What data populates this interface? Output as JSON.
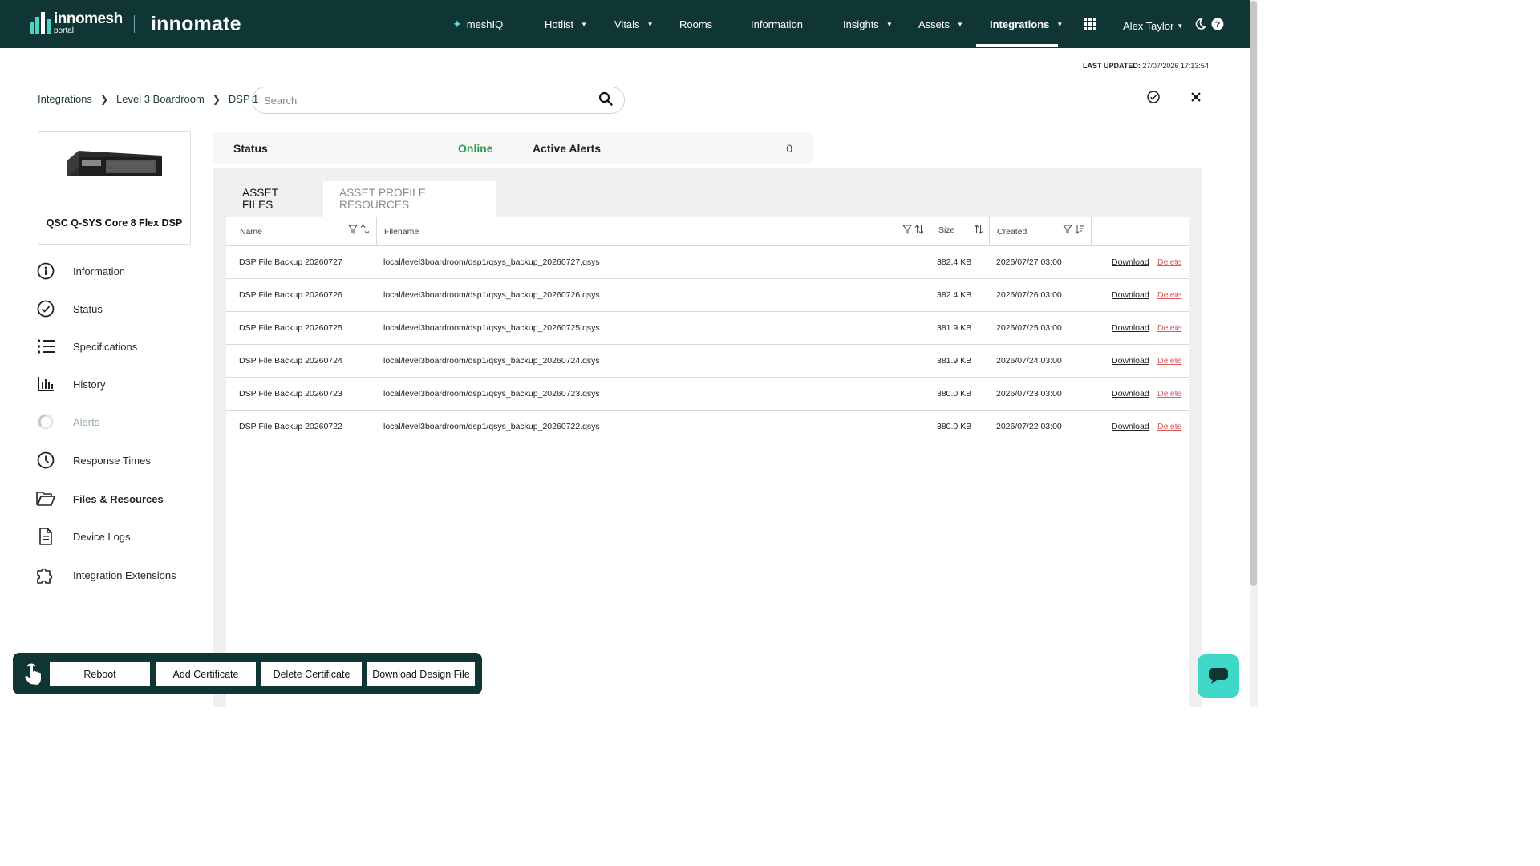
{
  "header": {
    "brand_primary": "innomesh",
    "brand_sub": "portal",
    "brand_secondary": "innomate",
    "nav": [
      {
        "label": "meshIQ",
        "has_caret": false
      },
      {
        "label": "Hotlist",
        "has_caret": true
      },
      {
        "label": "Vitals",
        "has_caret": true
      },
      {
        "label": "Rooms",
        "has_caret": false
      },
      {
        "label": "Information",
        "has_caret": false
      },
      {
        "label": "Insights",
        "has_caret": true
      },
      {
        "label": "Assets",
        "has_caret": true
      },
      {
        "label": "Integrations",
        "has_caret": true,
        "active": true
      }
    ],
    "user_name": "Alex Taylor",
    "icons": [
      "apps-grid-icon",
      "dark-mode-icon",
      "help-icon"
    ]
  },
  "last_updated": {
    "label": "LAST UPDATED:",
    "value": "27/07/2026 17:13:54"
  },
  "breadcrumb": [
    "Integrations",
    "Level 3 Boardroom",
    "DSP 1"
  ],
  "search": {
    "placeholder": "Search"
  },
  "device": {
    "name": "QSC Q-SYS Core 8 Flex DSP",
    "image": "dsp-device-image"
  },
  "side_menu": [
    {
      "label": "Information",
      "icon": "info-icon"
    },
    {
      "label": "Status",
      "icon": "check-circle-icon"
    },
    {
      "label": "Specifications",
      "icon": "list-icon"
    },
    {
      "label": "History",
      "icon": "bar-chart-icon"
    },
    {
      "label": "Alerts",
      "icon": "loading-spinner-icon",
      "disabled": true
    },
    {
      "label": "Response Times",
      "icon": "clock-icon"
    },
    {
      "label": "Files & Resources",
      "icon": "folder-open-icon",
      "active": true
    },
    {
      "label": "Device Logs",
      "icon": "document-icon"
    },
    {
      "label": "Integration Extensions",
      "icon": "puzzle-icon"
    }
  ],
  "status": {
    "label": "Status",
    "value": "Online",
    "alerts_label": "Active Alerts",
    "alerts_value": "0"
  },
  "tabs": [
    {
      "label": "ASSET FILES",
      "active": true
    },
    {
      "label": "ASSET PROFILE RESOURCES",
      "active": false
    }
  ],
  "table": {
    "columns": [
      "Name",
      "Filename",
      "Size",
      "Created"
    ],
    "rows": [
      {
        "name": "DSP File Backup 20260727",
        "filename": "local/level3boardroom/dsp1/qsys_backup_20260727.qsys",
        "size": "382.4 KB",
        "created": "2026/07/27 03:00"
      },
      {
        "name": "DSP File Backup 20260726",
        "filename": "local/level3boardroom/dsp1/qsys_backup_20260726.qsys",
        "size": "382.4 KB",
        "created": "2026/07/26 03:00"
      },
      {
        "name": "DSP File Backup 20260725",
        "filename": "local/level3boardroom/dsp1/qsys_backup_20260725.qsys",
        "size": "381.9 KB",
        "created": "2026/07/25 03:00"
      },
      {
        "name": "DSP File Backup 20260724",
        "filename": "local/level3boardroom/dsp1/qsys_backup_20260724.qsys",
        "size": "381.9 KB",
        "created": "2026/07/24 03:00"
      },
      {
        "name": "DSP File Backup 20260723",
        "filename": "local/level3boardroom/dsp1/qsys_backup_20260723.qsys",
        "size": "380.0 KB",
        "created": "2026/07/23 03:00"
      },
      {
        "name": "DSP File Backup 20260722",
        "filename": "local/level3boardroom/dsp1/qsys_backup_20260722.qsys",
        "size": "380.0 KB",
        "created": "2026/07/22 03:00"
      }
    ],
    "download_label": "Download",
    "delete_label": "Delete"
  },
  "actions": [
    "Reboot",
    "Add Certificate",
    "Delete Certificate",
    "Download Design File"
  ],
  "colors": {
    "header_bg": "#0f3535",
    "online": "#2e9e46",
    "delete": "#e0585b",
    "accent": "#3fd7c7"
  }
}
